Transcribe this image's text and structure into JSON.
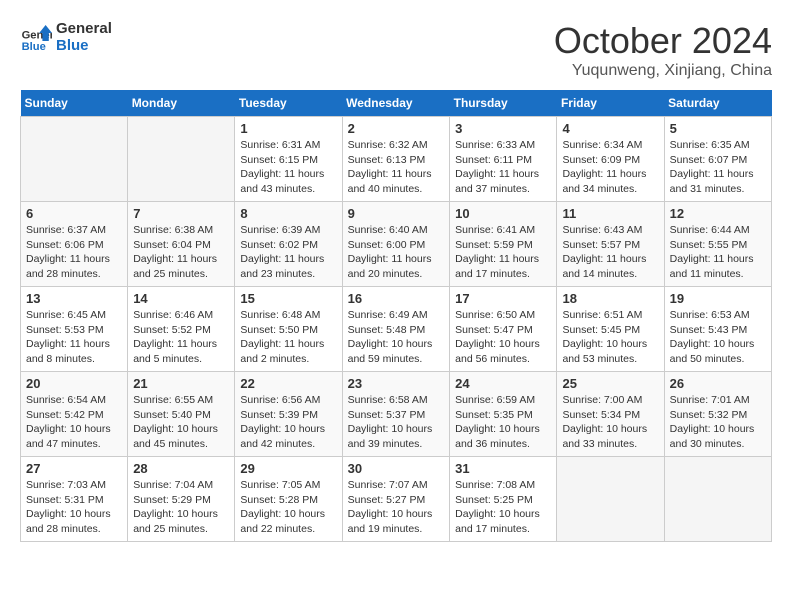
{
  "logo": {
    "line1": "General",
    "line2": "Blue"
  },
  "title": "October 2024",
  "location": "Yuqunweng, Xinjiang, China",
  "days_of_week": [
    "Sunday",
    "Monday",
    "Tuesday",
    "Wednesday",
    "Thursday",
    "Friday",
    "Saturday"
  ],
  "weeks": [
    [
      {
        "day": "",
        "info": ""
      },
      {
        "day": "",
        "info": ""
      },
      {
        "day": "1",
        "info": "Sunrise: 6:31 AM\nSunset: 6:15 PM\nDaylight: 11 hours\nand 43 minutes."
      },
      {
        "day": "2",
        "info": "Sunrise: 6:32 AM\nSunset: 6:13 PM\nDaylight: 11 hours\nand 40 minutes."
      },
      {
        "day": "3",
        "info": "Sunrise: 6:33 AM\nSunset: 6:11 PM\nDaylight: 11 hours\nand 37 minutes."
      },
      {
        "day": "4",
        "info": "Sunrise: 6:34 AM\nSunset: 6:09 PM\nDaylight: 11 hours\nand 34 minutes."
      },
      {
        "day": "5",
        "info": "Sunrise: 6:35 AM\nSunset: 6:07 PM\nDaylight: 11 hours\nand 31 minutes."
      }
    ],
    [
      {
        "day": "6",
        "info": "Sunrise: 6:37 AM\nSunset: 6:06 PM\nDaylight: 11 hours\nand 28 minutes."
      },
      {
        "day": "7",
        "info": "Sunrise: 6:38 AM\nSunset: 6:04 PM\nDaylight: 11 hours\nand 25 minutes."
      },
      {
        "day": "8",
        "info": "Sunrise: 6:39 AM\nSunset: 6:02 PM\nDaylight: 11 hours\nand 23 minutes."
      },
      {
        "day": "9",
        "info": "Sunrise: 6:40 AM\nSunset: 6:00 PM\nDaylight: 11 hours\nand 20 minutes."
      },
      {
        "day": "10",
        "info": "Sunrise: 6:41 AM\nSunset: 5:59 PM\nDaylight: 11 hours\nand 17 minutes."
      },
      {
        "day": "11",
        "info": "Sunrise: 6:43 AM\nSunset: 5:57 PM\nDaylight: 11 hours\nand 14 minutes."
      },
      {
        "day": "12",
        "info": "Sunrise: 6:44 AM\nSunset: 5:55 PM\nDaylight: 11 hours\nand 11 minutes."
      }
    ],
    [
      {
        "day": "13",
        "info": "Sunrise: 6:45 AM\nSunset: 5:53 PM\nDaylight: 11 hours\nand 8 minutes."
      },
      {
        "day": "14",
        "info": "Sunrise: 6:46 AM\nSunset: 5:52 PM\nDaylight: 11 hours\nand 5 minutes."
      },
      {
        "day": "15",
        "info": "Sunrise: 6:48 AM\nSunset: 5:50 PM\nDaylight: 11 hours\nand 2 minutes."
      },
      {
        "day": "16",
        "info": "Sunrise: 6:49 AM\nSunset: 5:48 PM\nDaylight: 10 hours\nand 59 minutes."
      },
      {
        "day": "17",
        "info": "Sunrise: 6:50 AM\nSunset: 5:47 PM\nDaylight: 10 hours\nand 56 minutes."
      },
      {
        "day": "18",
        "info": "Sunrise: 6:51 AM\nSunset: 5:45 PM\nDaylight: 10 hours\nand 53 minutes."
      },
      {
        "day": "19",
        "info": "Sunrise: 6:53 AM\nSunset: 5:43 PM\nDaylight: 10 hours\nand 50 minutes."
      }
    ],
    [
      {
        "day": "20",
        "info": "Sunrise: 6:54 AM\nSunset: 5:42 PM\nDaylight: 10 hours\nand 47 minutes."
      },
      {
        "day": "21",
        "info": "Sunrise: 6:55 AM\nSunset: 5:40 PM\nDaylight: 10 hours\nand 45 minutes."
      },
      {
        "day": "22",
        "info": "Sunrise: 6:56 AM\nSunset: 5:39 PM\nDaylight: 10 hours\nand 42 minutes."
      },
      {
        "day": "23",
        "info": "Sunrise: 6:58 AM\nSunset: 5:37 PM\nDaylight: 10 hours\nand 39 minutes."
      },
      {
        "day": "24",
        "info": "Sunrise: 6:59 AM\nSunset: 5:35 PM\nDaylight: 10 hours\nand 36 minutes."
      },
      {
        "day": "25",
        "info": "Sunrise: 7:00 AM\nSunset: 5:34 PM\nDaylight: 10 hours\nand 33 minutes."
      },
      {
        "day": "26",
        "info": "Sunrise: 7:01 AM\nSunset: 5:32 PM\nDaylight: 10 hours\nand 30 minutes."
      }
    ],
    [
      {
        "day": "27",
        "info": "Sunrise: 7:03 AM\nSunset: 5:31 PM\nDaylight: 10 hours\nand 28 minutes."
      },
      {
        "day": "28",
        "info": "Sunrise: 7:04 AM\nSunset: 5:29 PM\nDaylight: 10 hours\nand 25 minutes."
      },
      {
        "day": "29",
        "info": "Sunrise: 7:05 AM\nSunset: 5:28 PM\nDaylight: 10 hours\nand 22 minutes."
      },
      {
        "day": "30",
        "info": "Sunrise: 7:07 AM\nSunset: 5:27 PM\nDaylight: 10 hours\nand 19 minutes."
      },
      {
        "day": "31",
        "info": "Sunrise: 7:08 AM\nSunset: 5:25 PM\nDaylight: 10 hours\nand 17 minutes."
      },
      {
        "day": "",
        "info": ""
      },
      {
        "day": "",
        "info": ""
      }
    ]
  ]
}
